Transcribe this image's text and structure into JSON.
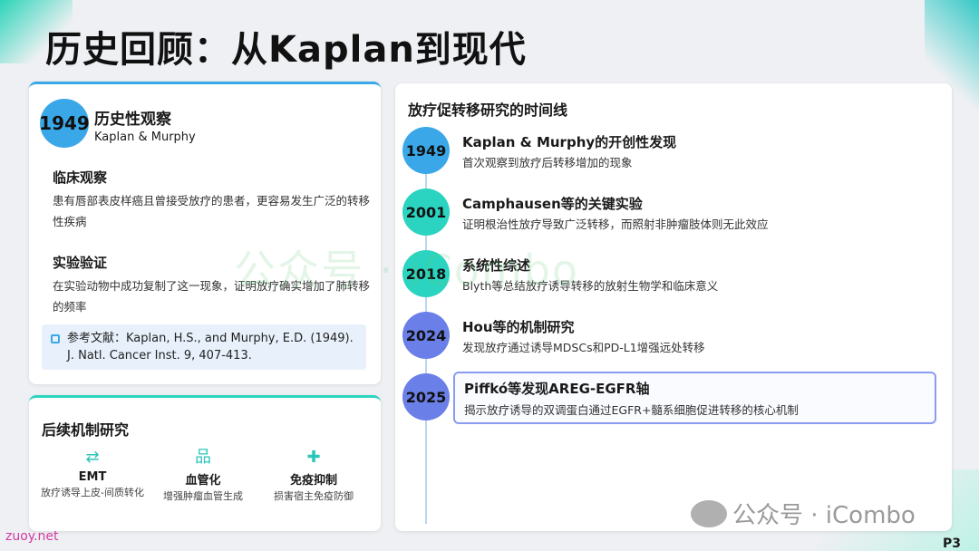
{
  "title": "历史回顾：从Kaplan到现代",
  "history_card": {
    "year": "1949",
    "heading": "历史性观察",
    "subheading": "Kaplan & Murphy",
    "clinical": {
      "title": "临床观察",
      "body": "患有唇部表皮样癌且曾接受放疗的患者，更容易发生广泛的转移性疾病"
    },
    "experiment": {
      "title": "实验验证",
      "body": "在实验动物中成功复制了这一现象，证明放疗确实增加了肺转移的频率"
    },
    "reference": "参考文献：Kaplan, H.S., and Murphy, E.D. (1949). J. Natl. Cancer Inst. 9, 407-413."
  },
  "mechanism_card": {
    "title": "后续机制研究",
    "items": [
      {
        "icon": "⇄",
        "title": "EMT",
        "desc": "放疗诱导上皮-间质转化"
      },
      {
        "icon": "品",
        "title": "血管化",
        "desc": "增强肿瘤血管生成"
      },
      {
        "icon": "✚",
        "title": "免疫抑制",
        "desc": "损害宿主免疫防御"
      }
    ]
  },
  "timeline_card": {
    "title": "放疗促转移研究的时间线",
    "items": [
      {
        "year": "1949",
        "title": "Kaplan & Murphy的开创性发现",
        "desc": "首次观察到放疗后转移增加的现象",
        "color": "#3aa8e8"
      },
      {
        "year": "2001",
        "title": "Camphausen等的关键实验",
        "desc": "证明根治性放疗导致广泛转移，而照射非肿瘤肢体则无此效应",
        "color": "#2bd4c0"
      },
      {
        "year": "2018",
        "title": "系统性综述",
        "desc": "Blyth等总结放疗诱导转移的放射生物学和临床意义",
        "color": "#2bd4c0"
      },
      {
        "year": "2024",
        "title": "Hou等的机制研究",
        "desc": "发现放疗通过诱导MDSCs和PD-L1增强远处转移",
        "color": "#6b7fe8"
      },
      {
        "year": "2025",
        "title": "Piffkó等发现AREG-EGFR轴",
        "desc": "揭示放疗诱导的双调蛋白通过EGFR+髓系细胞促进转移的核心机制",
        "color": "#6b7fe8"
      }
    ]
  },
  "watermark_center": "公众号 · iCombo",
  "watermark_corner": "公众号 · iCombo",
  "site": "zuoy.net",
  "page_number": "P3",
  "colors": {
    "accent_blue": "#3aa8e8",
    "accent_teal": "#2bd4c0",
    "accent_indigo": "#6b7fe8"
  }
}
